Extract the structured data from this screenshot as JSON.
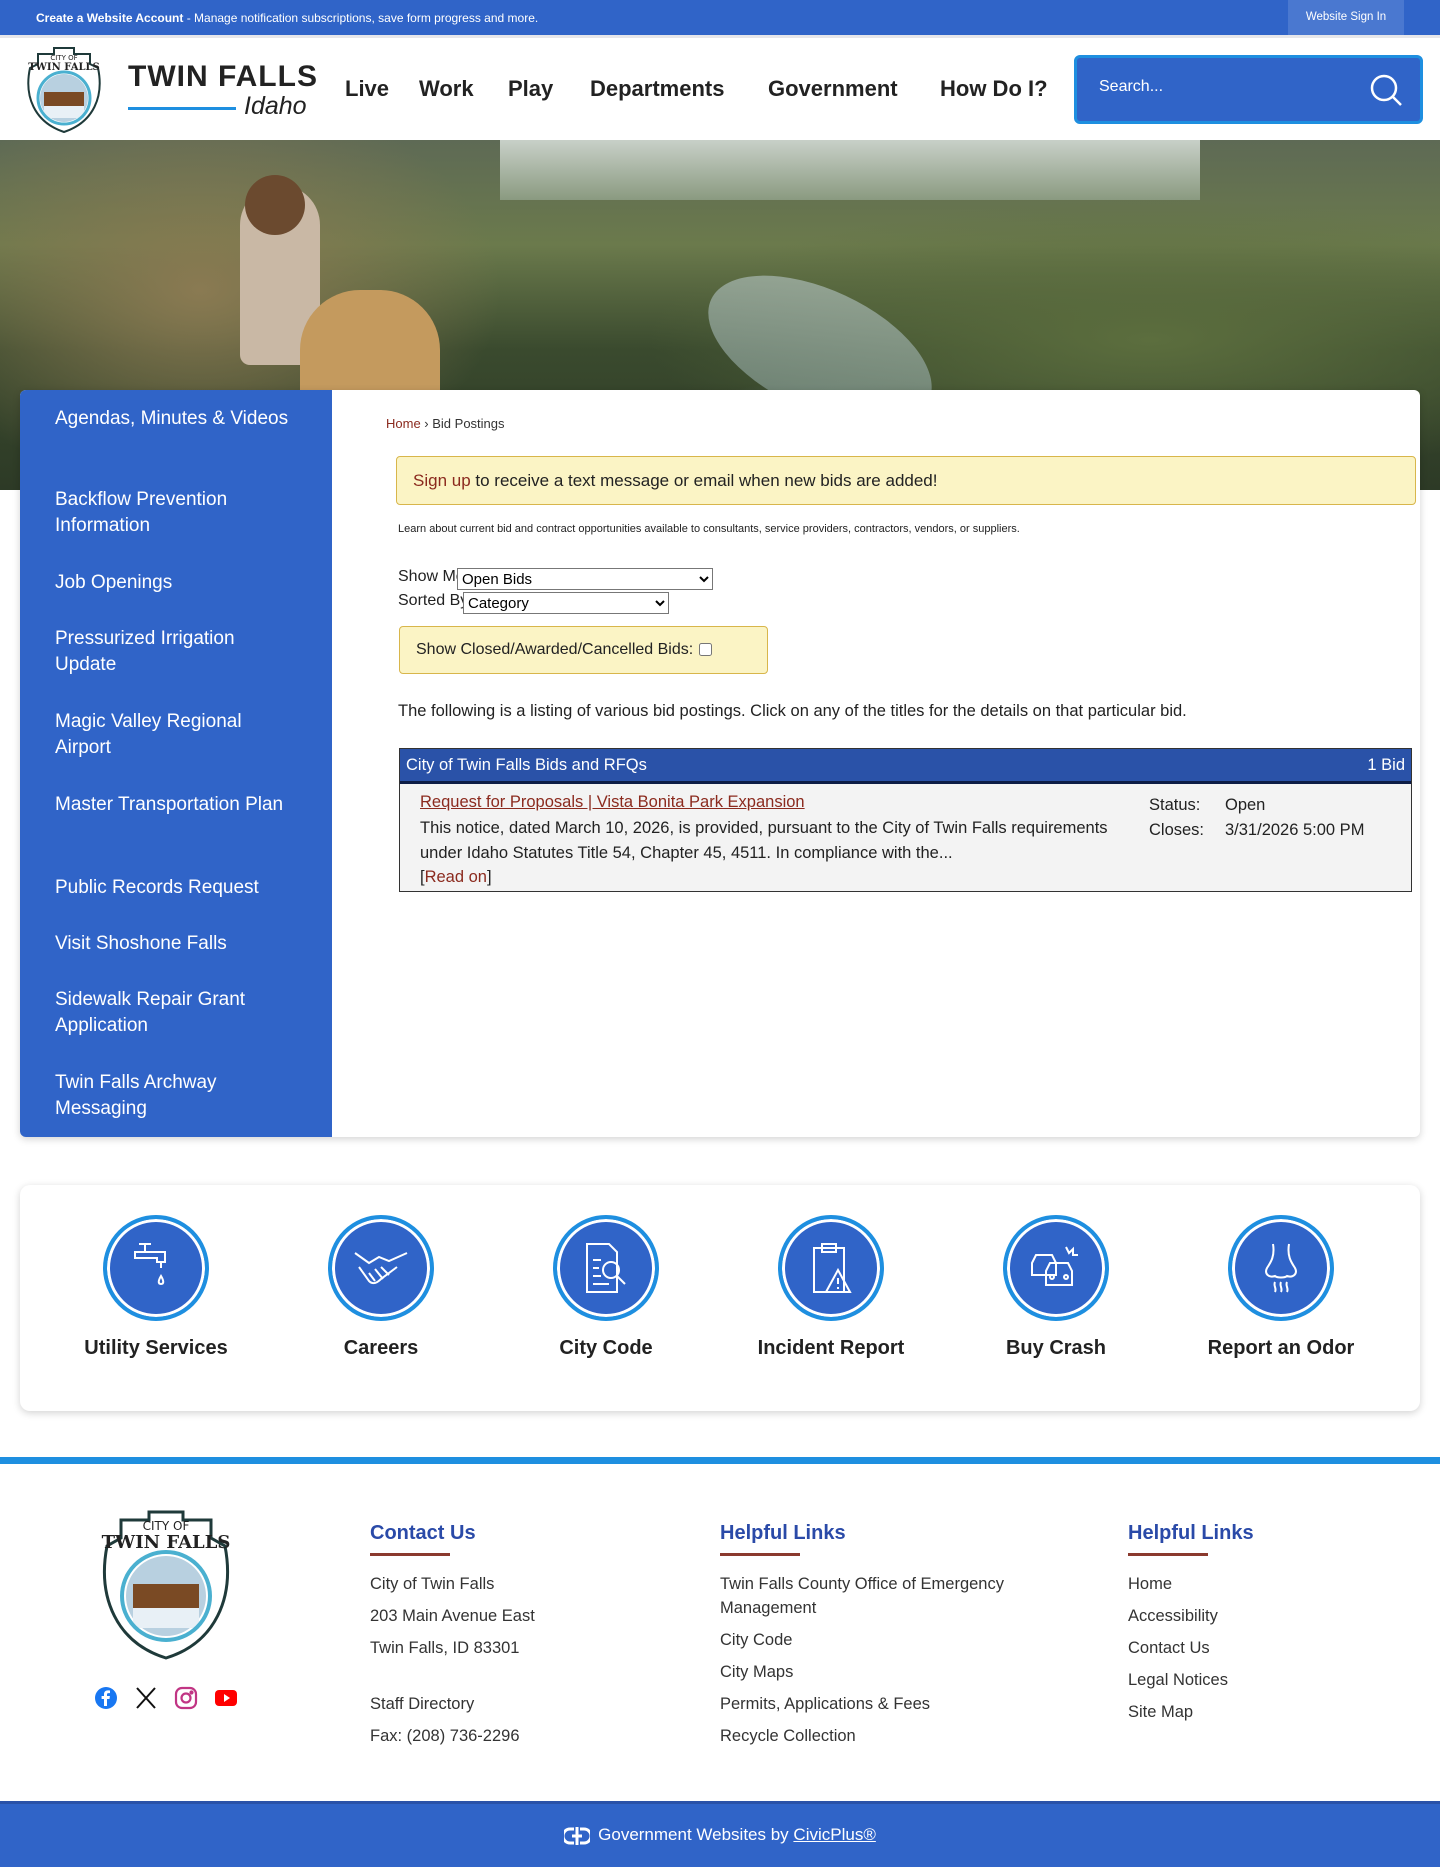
{
  "topbar": {
    "create_account": "Create a Website Account",
    "message": " - Manage notification subscriptions, save form progress and more.",
    "sign_in": "Website Sign In"
  },
  "header": {
    "logo_text": "City of Twin Falls - People Serving People",
    "title": "TWIN FALLS",
    "subtitle": "Idaho",
    "nav": [
      "Live",
      "Work",
      "Play",
      "Departments",
      "Government",
      "How Do I?"
    ],
    "search_placeholder": "Search..."
  },
  "sidebar": {
    "items": [
      "Agendas, Minutes & Videos",
      "Backflow Prevention Information",
      "Job Openings",
      "Pressurized Irrigation Update",
      "Magic Valley Regional Airport",
      "Master Transportation Plan",
      "Public Records Request",
      "Visit Shoshone Falls",
      "Sidewalk Repair Grant Application",
      "Twin Falls Archway Messaging"
    ]
  },
  "breadcrumb": {
    "home": "Home",
    "sep": " › ",
    "current": "Bid Postings"
  },
  "alert": {
    "link": "Sign up",
    "text": " to receive a text message or email when new bids are added!"
  },
  "learn_text": "Learn about current bid and contract opportunities available to consultants, service providers, contractors, vendors, or suppliers.",
  "filters": {
    "show_me_label": "Show Me",
    "show_me_value": "Open Bids",
    "sorted_by_label": "Sorted By",
    "sorted_by_value": "Category",
    "closed_label": "Show Closed/Awarded/Cancelled Bids:"
  },
  "listing_intro": "The following is a listing of various bid postings. Click on any of the titles for the details on that particular bid.",
  "bids": {
    "category": "City of Twin Falls Bids and RFQs",
    "count": "1 Bid",
    "items": [
      {
        "title": "Request for Proposals | Vista Bonita Park Expansion",
        "description": "This notice, dated March 10, 2026, is provided, pursuant to the City of Twin Falls requirements under Idaho Statutes Title 54, Chapter 45, 4511. In compliance with the...",
        "read_on": "Read on",
        "status_label": "Status:",
        "status": "Open",
        "closes_label": "Closes:",
        "closes": "3/31/2026 5:00 PM"
      }
    ]
  },
  "quick_links": [
    {
      "label": "Utility Services",
      "icon": "faucet-icon"
    },
    {
      "label": "Careers",
      "icon": "handshake-icon"
    },
    {
      "label": "City Code",
      "icon": "document-search-icon"
    },
    {
      "label": "Incident Report",
      "icon": "clipboard-warning-icon"
    },
    {
      "label": "Buy Crash",
      "icon": "car-crash-icon"
    },
    {
      "label": "Report an Odor",
      "icon": "nose-icon"
    }
  ],
  "footer": {
    "contact": {
      "heading": "Contact Us",
      "lines": [
        "City of Twin Falls",
        "203 Main Avenue East",
        "Twin Falls, ID 83301",
        "Staff Directory",
        "Fax: (208) 736-2296"
      ]
    },
    "links1": {
      "heading": "Helpful Links",
      "items": [
        "Twin Falls County Office of Emergency Management",
        "City Code",
        "City Maps",
        "Permits, Applications & Fees",
        "Recycle Collection"
      ]
    },
    "links2": {
      "heading": "Helpful Links",
      "items": [
        "Home",
        "Accessibility",
        "Contact Us",
        "Legal Notices",
        "Site Map"
      ]
    },
    "social": [
      "facebook",
      "x",
      "instagram",
      "youtube"
    ],
    "credit": "Government Websites by ",
    "credit_link": "CivicPlus®"
  },
  "colors": {
    "brand_blue": "#3064c8",
    "accent_blue": "#1e8fe0",
    "link_red": "#8b2a1e",
    "alert_yellow": "#fbf4c5"
  }
}
